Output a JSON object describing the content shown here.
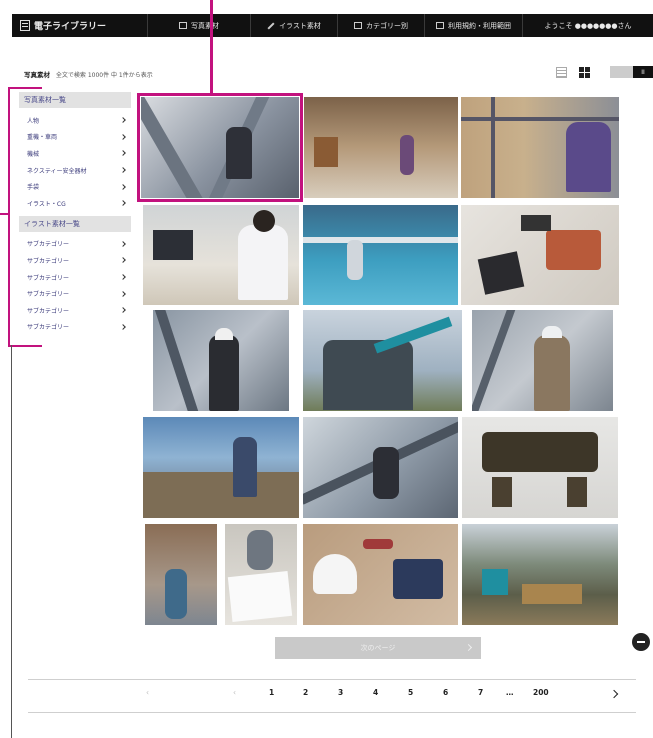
{
  "nav": {
    "brand": "電子ライブラリー",
    "items": [
      "写真素材",
      "イラスト素材",
      "カテゴリー別",
      "利用規約・利用範囲",
      "ようこそ ●●●●●●●さん"
    ]
  },
  "results": {
    "label": "写真素材",
    "summary": "全文で検索 1000件 中 1件から表示"
  },
  "toggle": {
    "on_label": "II"
  },
  "sidebar": {
    "photo_heading": "写真素材一覧",
    "photo_items": [
      "人物",
      "重機・車両",
      "機械",
      "ネクスティー安全器材",
      "手袋",
      "イラスト・CG"
    ],
    "illust_heading": "イラスト素材一覧",
    "illust_items": [
      "サブカテゴリー",
      "サブカテゴリー",
      "サブカテゴリー",
      "サブカテゴリー",
      "サブカテゴリー",
      "サブカテゴリー"
    ]
  },
  "more_button": "次のページ",
  "pagination": {
    "prev": "‹",
    "first": "‹",
    "pages": [
      "1",
      "2",
      "3",
      "4",
      "5",
      "6",
      "7"
    ],
    "ellipsis": "…",
    "last": "200"
  },
  "colors": {
    "annotation": "#c2127e",
    "nav_bg": "#111111",
    "sidebar_text": "#3a3a7a"
  }
}
